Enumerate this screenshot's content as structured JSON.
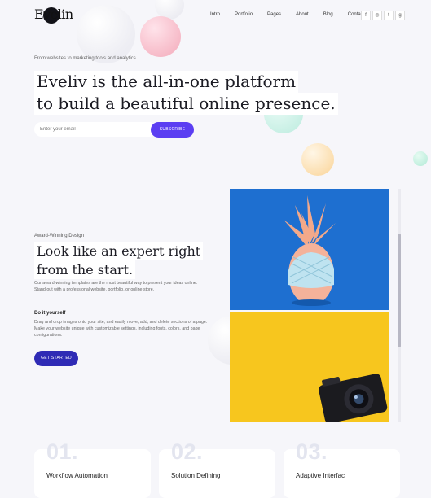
{
  "brand": {
    "logo_text": "Evelin"
  },
  "nav": {
    "items": [
      "Intro",
      "Portfolio",
      "Pages",
      "About",
      "Blog",
      "Contact"
    ]
  },
  "social": {
    "icons": [
      "facebook-icon",
      "instagram-icon",
      "twitter-icon",
      "google-icon"
    ],
    "glyphs": [
      "f",
      "◎",
      "t",
      "g"
    ]
  },
  "hero": {
    "tagline": "From websites to marketing tools and analytics.",
    "headline_line1": "Eveliv is the all-in-one platform",
    "headline_line2": "to build a beautiful online presence.",
    "email_placeholder": "Enter your email",
    "subscribe_label": "SUBSCRIBE"
  },
  "feature": {
    "eyebrow": "Award-Winning Design",
    "title_line1": "Look like an expert right",
    "title_line2": "from the start.",
    "description": "Our award-winning templates are the most beautiful way to present your ideas online. Stand out with a professional website, portfolio, or online store.",
    "diy_title": "Do it yourself",
    "diy_text": "Drag and drop images onto your site, and easily move, add, and delete sections of a page. Make your website unique with customizable settings, including fonts, colors, and page configurations.",
    "cta_label": "GET STARTED"
  },
  "cards": [
    {
      "number": "01.",
      "title": "Workflow Automation"
    },
    {
      "number": "02.",
      "title": "Solution Defining"
    },
    {
      "number": "03.",
      "title": "Adaptive Interfac"
    }
  ],
  "colors": {
    "accent": "#5b3ef2",
    "accent_dark": "#2f2bb5",
    "background": "#f6f6fa"
  }
}
